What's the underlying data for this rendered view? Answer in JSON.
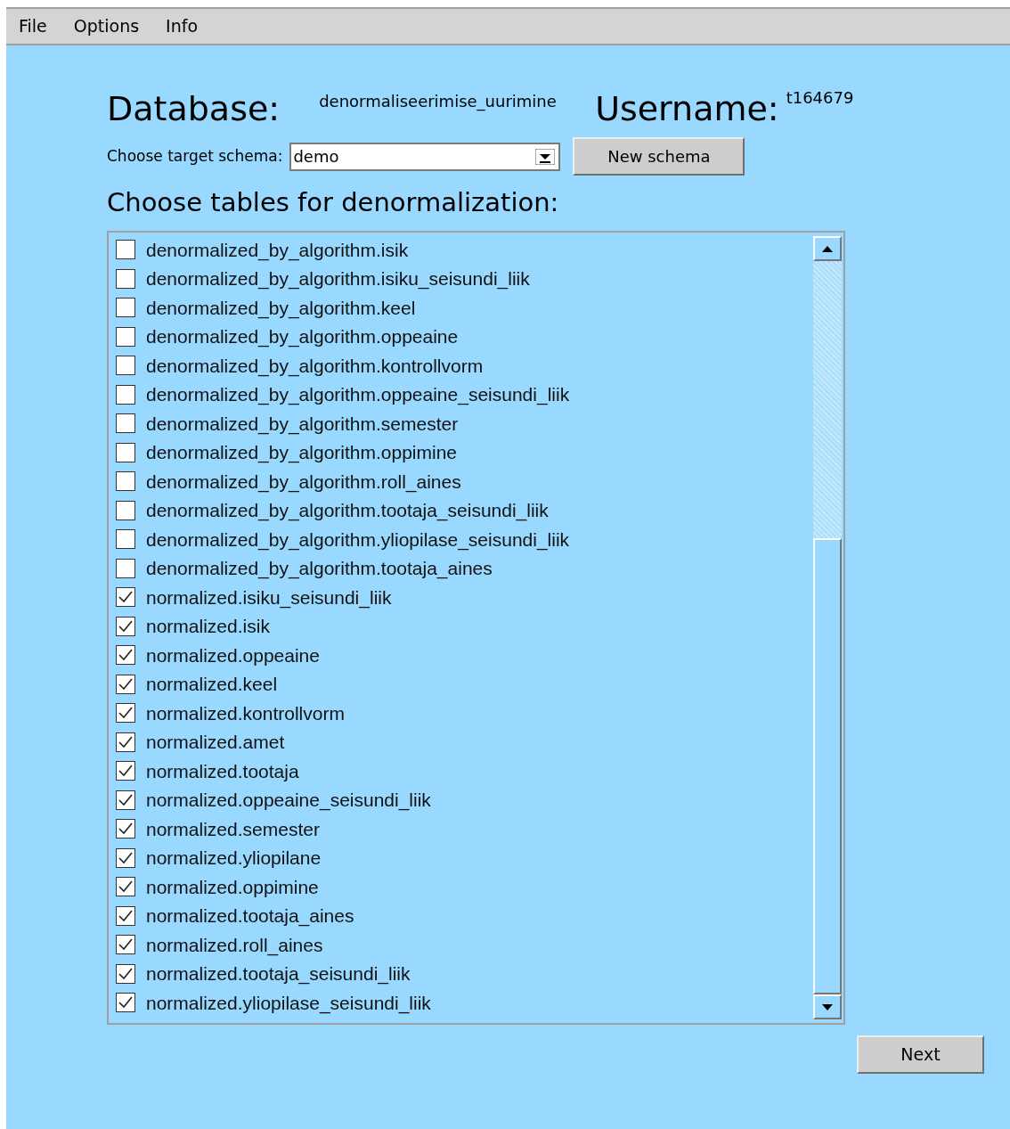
{
  "menu": [
    "File",
    "Options",
    "Info"
  ],
  "database": {
    "label": "Database:",
    "value": "denormaliseerimise_uurimine"
  },
  "username": {
    "label": "Username:",
    "value": "t164679"
  },
  "schema": {
    "label": "Choose target schema:",
    "value": "demo"
  },
  "new_schema_button": "New schema",
  "tables_heading": "Choose tables for denormalization:",
  "tables": [
    {
      "label": "denormalized_by_algorithm.isik",
      "checked": false
    },
    {
      "label": "denormalized_by_algorithm.isiku_seisundi_liik",
      "checked": false
    },
    {
      "label": "denormalized_by_algorithm.keel",
      "checked": false
    },
    {
      "label": "denormalized_by_algorithm.oppeaine",
      "checked": false
    },
    {
      "label": "denormalized_by_algorithm.kontrollvorm",
      "checked": false
    },
    {
      "label": "denormalized_by_algorithm.oppeaine_seisundi_liik",
      "checked": false
    },
    {
      "label": "denormalized_by_algorithm.semester",
      "checked": false
    },
    {
      "label": "denormalized_by_algorithm.oppimine",
      "checked": false
    },
    {
      "label": "denormalized_by_algorithm.roll_aines",
      "checked": false
    },
    {
      "label": "denormalized_by_algorithm.tootaja_seisundi_liik",
      "checked": false
    },
    {
      "label": "denormalized_by_algorithm.yliopilase_seisundi_liik",
      "checked": false
    },
    {
      "label": "denormalized_by_algorithm.tootaja_aines",
      "checked": false
    },
    {
      "label": "normalized.isiku_seisundi_liik",
      "checked": true
    },
    {
      "label": "normalized.isik",
      "checked": true
    },
    {
      "label": "normalized.oppeaine",
      "checked": true
    },
    {
      "label": "normalized.keel",
      "checked": true
    },
    {
      "label": "normalized.kontrollvorm",
      "checked": true
    },
    {
      "label": "normalized.amet",
      "checked": true
    },
    {
      "label": "normalized.tootaja",
      "checked": true
    },
    {
      "label": "normalized.oppeaine_seisundi_liik",
      "checked": true
    },
    {
      "label": "normalized.semester",
      "checked": true
    },
    {
      "label": "normalized.yliopilane",
      "checked": true
    },
    {
      "label": "normalized.oppimine",
      "checked": true
    },
    {
      "label": "normalized.tootaja_aines",
      "checked": true
    },
    {
      "label": "normalized.roll_aines",
      "checked": true
    },
    {
      "label": "normalized.tootaja_seisundi_liik",
      "checked": true
    },
    {
      "label": "normalized.yliopilase_seisundi_liik",
      "checked": true
    }
  ],
  "next_button": "Next"
}
